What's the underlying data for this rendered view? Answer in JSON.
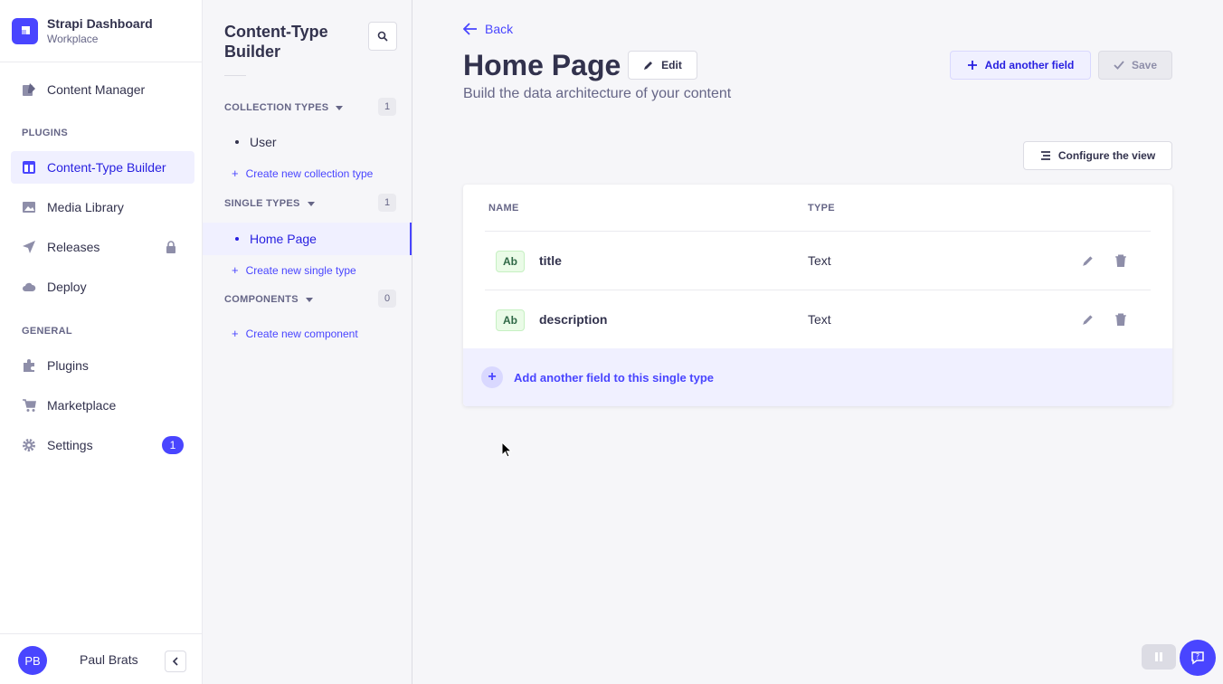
{
  "brand": {
    "title": "Strapi Dashboard",
    "subtitle": "Workplace"
  },
  "nav": {
    "content_manager": "Content Manager",
    "plugins_section": "PLUGINS",
    "content_type_builder": "Content-Type Builder",
    "media_library": "Media Library",
    "releases": "Releases",
    "deploy": "Deploy",
    "general_section": "GENERAL",
    "plugins": "Plugins",
    "marketplace": "Marketplace",
    "settings": "Settings",
    "settings_badge": "1"
  },
  "user": {
    "initials": "PB",
    "name": "Paul Brats"
  },
  "subnav": {
    "title": "Content-Type Builder",
    "collection_types": {
      "label": "COLLECTION TYPES",
      "count": "1",
      "items": [
        "User"
      ],
      "create": "Create new collection type"
    },
    "single_types": {
      "label": "SINGLE TYPES",
      "count": "1",
      "items": [
        "Home Page"
      ],
      "create": "Create new single type"
    },
    "components": {
      "label": "COMPONENTS",
      "count": "0",
      "create": "Create new component"
    }
  },
  "main": {
    "back": "Back",
    "title": "Home Page",
    "edit": "Edit",
    "subtitle": "Build the data architecture of your content",
    "add_field": "Add another field",
    "save": "Save",
    "configure_view": "Configure the view",
    "table": {
      "headers": [
        "NAME",
        "TYPE"
      ],
      "rows": [
        {
          "badge": "Ab",
          "name": "title",
          "type": "Text"
        },
        {
          "badge": "Ab",
          "name": "description",
          "type": "Text"
        }
      ],
      "add_row": "Add another field to this single type"
    }
  },
  "colors": {
    "primary": "#4945ff",
    "active_bg": "#f0f0ff",
    "text_badge_bg": "#eafbe7"
  }
}
